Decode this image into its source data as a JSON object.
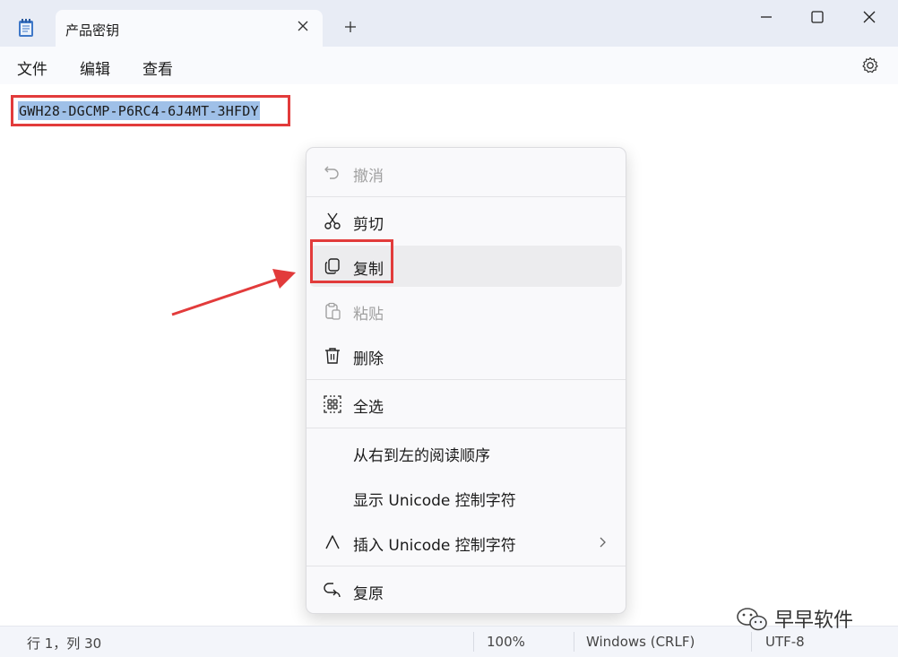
{
  "window": {
    "tab_title": "产品密钥",
    "icons": {
      "app": "notepad-icon",
      "tab_close": "close-icon",
      "new_tab": "plus-icon",
      "minimize": "minimize-icon",
      "maximize": "maximize-icon",
      "close": "close-icon"
    }
  },
  "menubar": {
    "items": [
      "文件",
      "编辑",
      "查看"
    ],
    "settings_icon": "gear-icon"
  },
  "editor": {
    "content": "GWH28-DGCMP-P6RC4-6J4MT-3HFDY",
    "selection_color": "#9fc0e8"
  },
  "context_menu": {
    "items": [
      {
        "label": "撤消",
        "icon": "undo-icon",
        "disabled": true
      },
      {
        "label": "剪切",
        "icon": "scissors-icon",
        "disabled": false
      },
      {
        "label": "复制",
        "icon": "copy-icon",
        "disabled": false,
        "hovered": true
      },
      {
        "label": "粘贴",
        "icon": "clipboard-icon",
        "disabled": true
      },
      {
        "label": "删除",
        "icon": "trash-icon",
        "disabled": false
      },
      {
        "label": "全选",
        "icon": "select-all-icon",
        "disabled": false
      },
      {
        "label": "从右到左的阅读顺序",
        "icon": "",
        "disabled": false
      },
      {
        "label": "显示 Unicode 控制字符",
        "icon": "",
        "disabled": false
      },
      {
        "label": "插入 Unicode 控制字符",
        "icon": "caret-icon",
        "disabled": false,
        "submenu": true
      },
      {
        "label": "复原",
        "icon": "reconversion-icon",
        "disabled": false
      }
    ]
  },
  "statusbar": {
    "position": "行 1，列 30",
    "zoom": "100%",
    "line_ending": "Windows (CRLF)",
    "encoding": "UTF-8"
  },
  "watermark": {
    "text": "早早软件",
    "icon": "wechat-icon"
  },
  "annotation": {
    "color": "#e23b3b"
  }
}
